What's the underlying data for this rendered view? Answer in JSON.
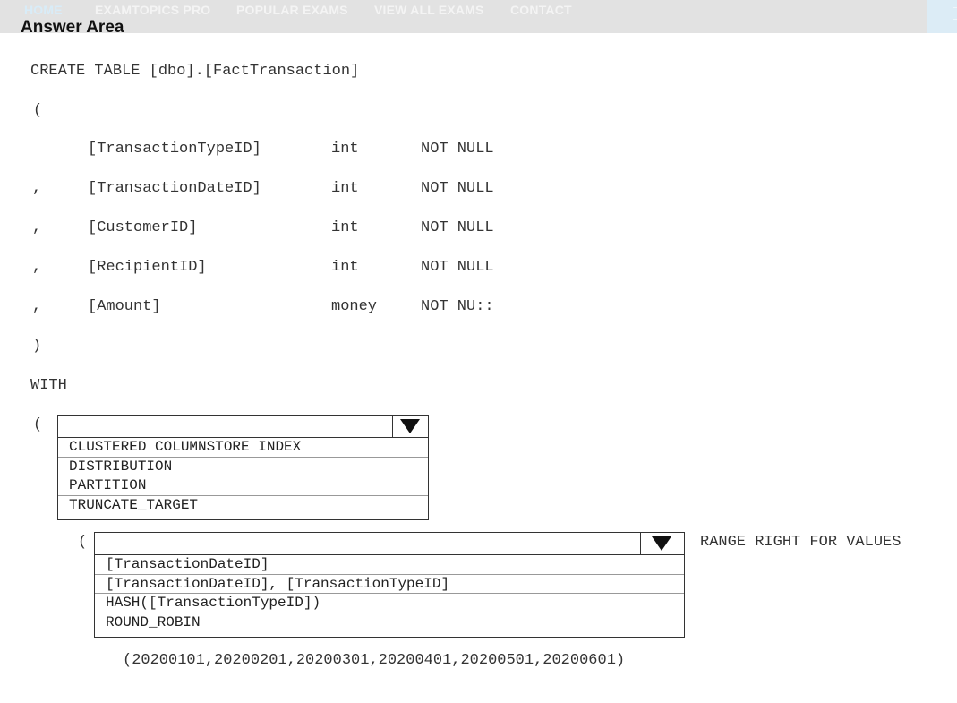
{
  "nav": {
    "items": [
      "HOME",
      "EXAMTOPICS PRO",
      "POPULAR EXAMS",
      "VIEW ALL EXAMS",
      "CONTACT"
    ]
  },
  "answer_area": {
    "title": "Answer Area"
  },
  "code": {
    "create_line": "CREATE TABLE [dbo].[FactTransaction]",
    "open_paren": "(",
    "columns": [
      {
        "prefix": "",
        "name": "[TransactionTypeID]",
        "type": "int",
        "constraint": "NOT NULL"
      },
      {
        "prefix": ",",
        "name": "[TransactionDateID]",
        "type": "int",
        "constraint": "NOT NULL"
      },
      {
        "prefix": ",",
        "name": "[CustomerID]",
        "type": "int",
        "constraint": "NOT NULL"
      },
      {
        "prefix": ",",
        "name": "[RecipientID]",
        "type": "int",
        "constraint": "NOT NULL"
      },
      {
        "prefix": ",",
        "name": "[Amount]",
        "type": "money",
        "constraint": "NOT NU::"
      }
    ],
    "close_paren": ")",
    "with_kw": "WITH",
    "with_open": "(",
    "inner_open": "(",
    "range_text": "RANGE RIGHT FOR VALUES",
    "values_line": "(20200101,20200201,20200301,20200401,20200501,20200601)"
  },
  "dropdown1": {
    "selected": "",
    "options": [
      "CLUSTERED COLUMNSTORE INDEX",
      "DISTRIBUTION",
      "PARTITION",
      "TRUNCATE_TARGET"
    ]
  },
  "dropdown2": {
    "selected": "",
    "options": [
      "[TransactionDateID]",
      "[TransactionDateID], [TransactionTypeID]",
      "HASH([TransactionTypeID])",
      "ROUND_ROBIN"
    ]
  }
}
